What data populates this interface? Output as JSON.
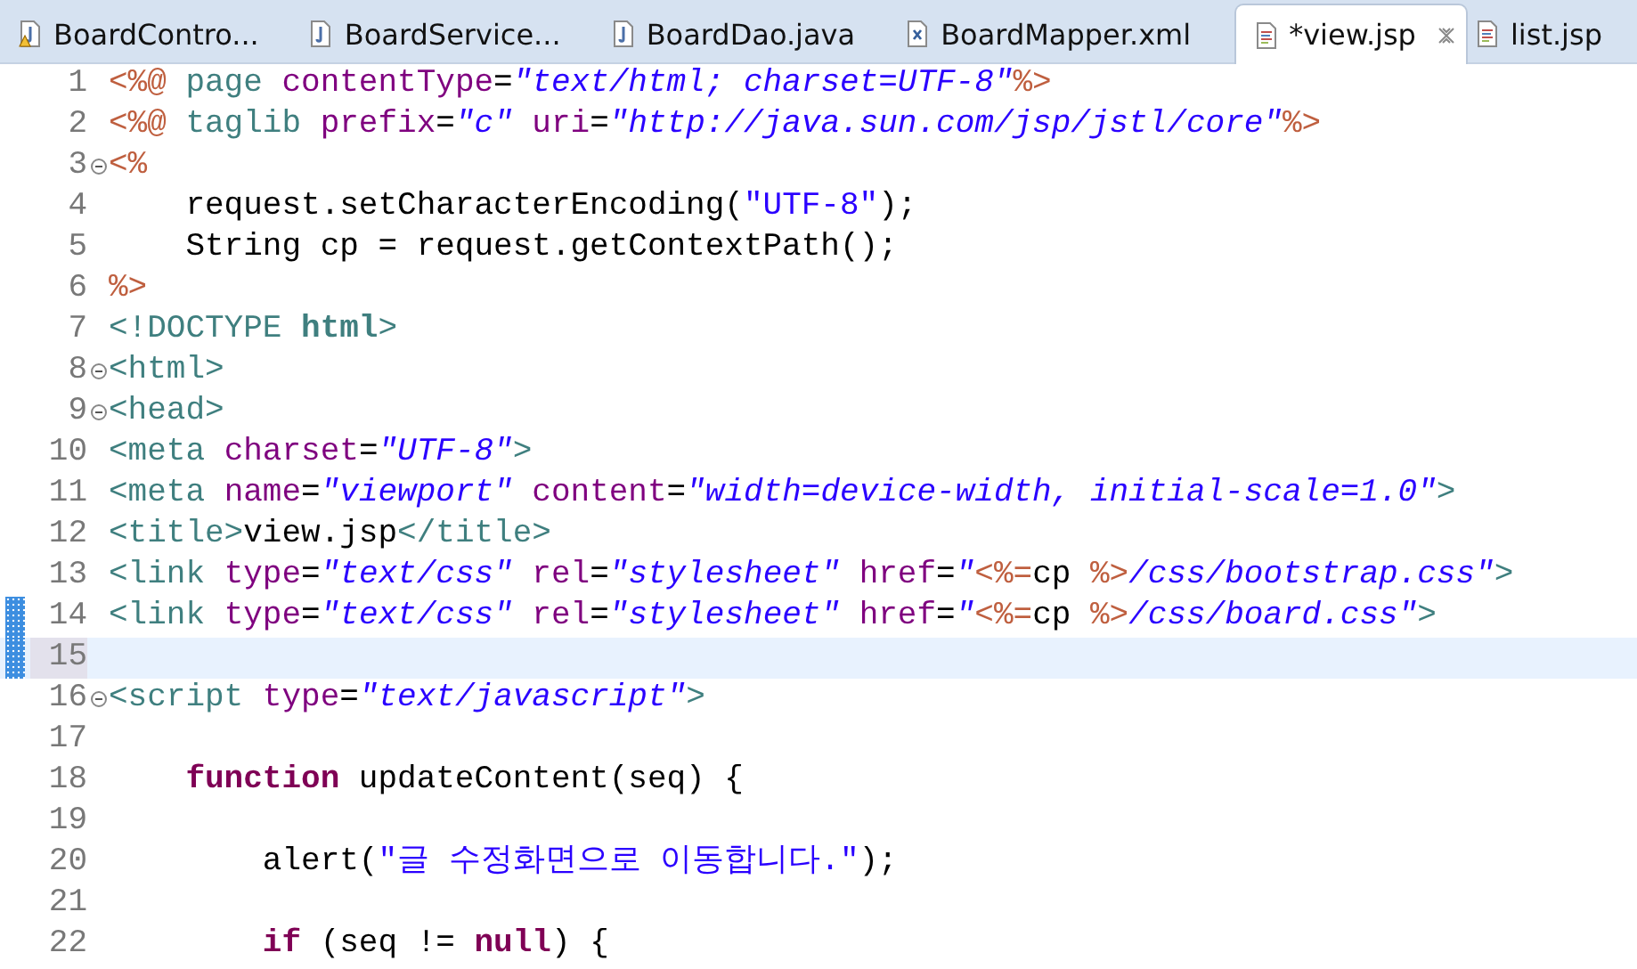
{
  "tabs": [
    {
      "label": "BoardContro...",
      "kind": "java-warning",
      "selected": false
    },
    {
      "label": "BoardService...",
      "kind": "java",
      "selected": false
    },
    {
      "label": "BoardDao.java",
      "kind": "java",
      "selected": false
    },
    {
      "label": "BoardMapper.xml",
      "kind": "xml",
      "selected": false
    },
    {
      "label": "*view.jsp",
      "kind": "jsp",
      "selected": true
    },
    {
      "label": "list.jsp",
      "kind": "jsp",
      "selected": false
    }
  ],
  "editor": {
    "lines": [
      {
        "number": "1",
        "fold": false,
        "current": false,
        "changed": false,
        "tokens": [
          {
            "kind": "delim",
            "text": "<%@"
          },
          {
            "kind": "tag",
            "text": " page"
          },
          {
            "kind": "attr",
            "text": " contentType"
          },
          {
            "kind": "plain",
            "text": "="
          },
          {
            "kind": "str",
            "text": "\"text/html; charset=UTF-8\""
          },
          {
            "kind": "delim",
            "text": "%>"
          }
        ]
      },
      {
        "number": "2",
        "fold": false,
        "current": false,
        "changed": false,
        "tokens": [
          {
            "kind": "delim",
            "text": "<%@"
          },
          {
            "kind": "tag",
            "text": " taglib"
          },
          {
            "kind": "attr",
            "text": " prefix"
          },
          {
            "kind": "plain",
            "text": "="
          },
          {
            "kind": "str",
            "text": "\"c\""
          },
          {
            "kind": "attr",
            "text": " uri"
          },
          {
            "kind": "plain",
            "text": "="
          },
          {
            "kind": "str",
            "text": "\"http://java.sun.com/jsp/jstl/core\""
          },
          {
            "kind": "delim",
            "text": "%>"
          }
        ]
      },
      {
        "number": "3",
        "fold": true,
        "current": false,
        "changed": false,
        "tokens": [
          {
            "kind": "delim",
            "text": "<%"
          }
        ]
      },
      {
        "number": "4",
        "fold": false,
        "current": false,
        "changed": false,
        "tokens": [
          {
            "kind": "plain",
            "text": "    request.setCharacterEncoding("
          },
          {
            "kind": "jsstr",
            "text": "\"UTF-8\""
          },
          {
            "kind": "plain",
            "text": ");"
          }
        ]
      },
      {
        "number": "5",
        "fold": false,
        "current": false,
        "changed": false,
        "tokens": [
          {
            "kind": "plain",
            "text": "    String cp = request.getContextPath();"
          }
        ]
      },
      {
        "number": "6",
        "fold": false,
        "current": false,
        "changed": false,
        "tokens": [
          {
            "kind": "delim",
            "text": "%>"
          }
        ]
      },
      {
        "number": "7",
        "fold": false,
        "current": false,
        "changed": false,
        "tokens": [
          {
            "kind": "tag",
            "text": "<!DOCTYPE "
          },
          {
            "kind": "tagbold",
            "text": "html"
          },
          {
            "kind": "tag",
            "text": ">"
          }
        ]
      },
      {
        "number": "8",
        "fold": true,
        "current": false,
        "changed": false,
        "tokens": [
          {
            "kind": "tag",
            "text": "<html>"
          }
        ]
      },
      {
        "number": "9",
        "fold": true,
        "current": false,
        "changed": false,
        "tokens": [
          {
            "kind": "tag",
            "text": "<head>"
          }
        ]
      },
      {
        "number": "10",
        "fold": false,
        "current": false,
        "changed": false,
        "tokens": [
          {
            "kind": "tag",
            "text": "<meta"
          },
          {
            "kind": "attr",
            "text": " charset"
          },
          {
            "kind": "plain",
            "text": "="
          },
          {
            "kind": "str",
            "text": "\"UTF-8\""
          },
          {
            "kind": "tag",
            "text": ">"
          }
        ]
      },
      {
        "number": "11",
        "fold": false,
        "current": false,
        "changed": false,
        "tokens": [
          {
            "kind": "tag",
            "text": "<meta"
          },
          {
            "kind": "attr",
            "text": " name"
          },
          {
            "kind": "plain",
            "text": "="
          },
          {
            "kind": "str",
            "text": "\"viewport\""
          },
          {
            "kind": "attr",
            "text": " content"
          },
          {
            "kind": "plain",
            "text": "="
          },
          {
            "kind": "str",
            "text": "\"width=device-width, initial-scale=1.0\""
          },
          {
            "kind": "tag",
            "text": ">"
          }
        ]
      },
      {
        "number": "12",
        "fold": false,
        "current": false,
        "changed": false,
        "tokens": [
          {
            "kind": "tag",
            "text": "<title>"
          },
          {
            "kind": "plain",
            "text": "view.jsp"
          },
          {
            "kind": "tag",
            "text": "</title>"
          }
        ]
      },
      {
        "number": "13",
        "fold": false,
        "current": false,
        "changed": false,
        "tokens": [
          {
            "kind": "tag",
            "text": "<link"
          },
          {
            "kind": "attr",
            "text": " type"
          },
          {
            "kind": "plain",
            "text": "="
          },
          {
            "kind": "str",
            "text": "\"text/css\""
          },
          {
            "kind": "attr",
            "text": " rel"
          },
          {
            "kind": "plain",
            "text": "="
          },
          {
            "kind": "str",
            "text": "\"stylesheet\""
          },
          {
            "kind": "attr",
            "text": " href"
          },
          {
            "kind": "plain",
            "text": "="
          },
          {
            "kind": "str",
            "text": "\""
          },
          {
            "kind": "delim",
            "text": "<%="
          },
          {
            "kind": "plain",
            "text": "cp "
          },
          {
            "kind": "delim",
            "text": "%>"
          },
          {
            "kind": "str",
            "text": "/css/bootstrap.css\""
          },
          {
            "kind": "tag",
            "text": ">"
          }
        ]
      },
      {
        "number": "14",
        "fold": false,
        "current": false,
        "changed": true,
        "tokens": [
          {
            "kind": "tag",
            "text": "<link"
          },
          {
            "kind": "attr",
            "text": " type"
          },
          {
            "kind": "plain",
            "text": "="
          },
          {
            "kind": "str",
            "text": "\"text/css\""
          },
          {
            "kind": "attr",
            "text": " rel"
          },
          {
            "kind": "plain",
            "text": "="
          },
          {
            "kind": "str",
            "text": "\"stylesheet\""
          },
          {
            "kind": "attr",
            "text": " href"
          },
          {
            "kind": "plain",
            "text": "="
          },
          {
            "kind": "str",
            "text": "\""
          },
          {
            "kind": "delim",
            "text": "<%="
          },
          {
            "kind": "plain",
            "text": "cp "
          },
          {
            "kind": "delim",
            "text": "%>"
          },
          {
            "kind": "str",
            "text": "/css/board.css\""
          },
          {
            "kind": "tag",
            "text": ">"
          }
        ]
      },
      {
        "number": "15",
        "fold": false,
        "current": true,
        "changed": true
      },
      {
        "number": "16",
        "fold": true,
        "current": false,
        "changed": false,
        "tokens": [
          {
            "kind": "tag",
            "text": "<script"
          },
          {
            "kind": "attr",
            "text": " type"
          },
          {
            "kind": "plain",
            "text": "="
          },
          {
            "kind": "str",
            "text": "\"text/javascript\""
          },
          {
            "kind": "tag",
            "text": ">"
          }
        ]
      },
      {
        "number": "17",
        "fold": false,
        "current": false,
        "changed": false
      },
      {
        "number": "18",
        "fold": false,
        "current": false,
        "changed": false,
        "tokens": [
          {
            "kind": "keyword",
            "text": "    function"
          },
          {
            "kind": "plain",
            "text": " updateContent(seq) {"
          }
        ]
      },
      {
        "number": "19",
        "fold": false,
        "current": false,
        "changed": false
      },
      {
        "number": "20",
        "fold": false,
        "current": false,
        "changed": false,
        "tokens": [
          {
            "kind": "plain",
            "text": "        alert("
          },
          {
            "kind": "jsstr",
            "text": "\"글 수정화면으로 이동합니다.\""
          },
          {
            "kind": "plain",
            "text": ");"
          }
        ]
      },
      {
        "number": "21",
        "fold": false,
        "current": false,
        "changed": false
      },
      {
        "number": "22",
        "fold": false,
        "current": false,
        "changed": false,
        "tokens": [
          {
            "kind": "keyword",
            "text": "        if"
          },
          {
            "kind": "plain",
            "text": " (seq != "
          },
          {
            "kind": "keyword",
            "text": "null"
          },
          {
            "kind": "plain",
            "text": ") {"
          }
        ]
      }
    ]
  }
}
